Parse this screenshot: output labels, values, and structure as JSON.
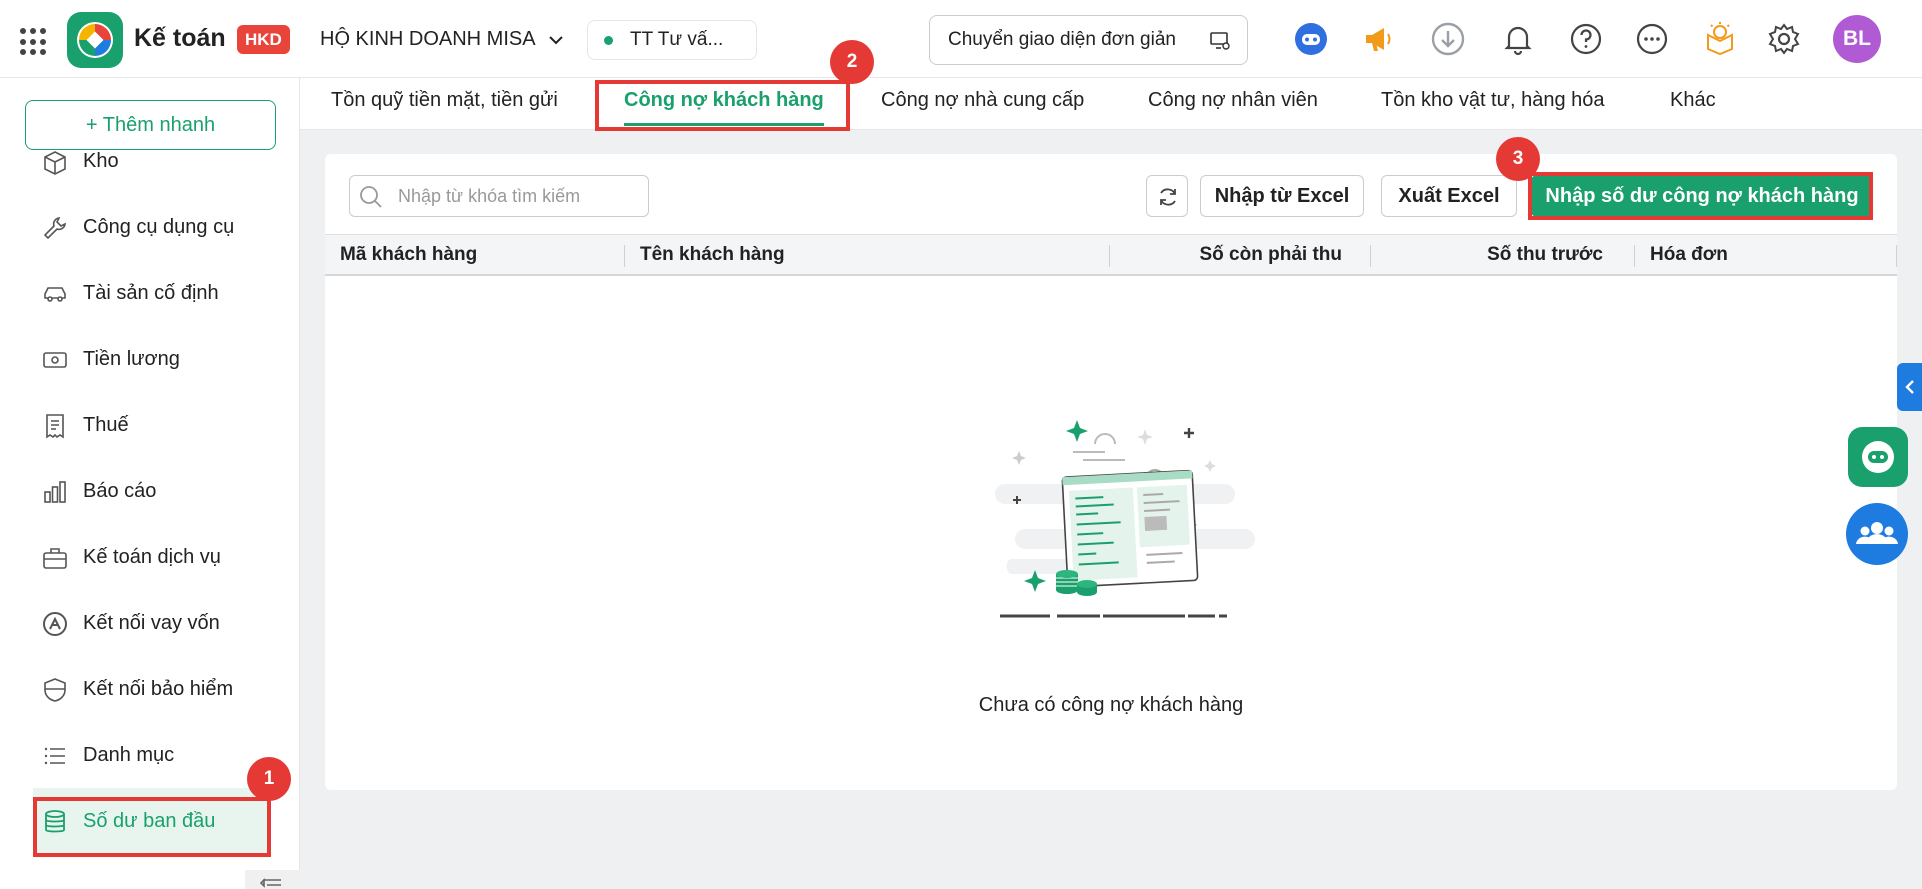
{
  "header": {
    "app_name": "Kế toán",
    "app_badge": "HKD",
    "company": "HỘ KINH DOANH MISA",
    "branch": "TT Tư vấ...",
    "switch_ui": "Chuyển giao diện đơn giản",
    "avatar_initials": "BL",
    "icons": [
      "apps-grid-icon",
      "misa-assistant-icon",
      "megaphone-icon",
      "download-icon",
      "bell-icon",
      "help-icon",
      "more-icon",
      "idea-icon",
      "gear-icon"
    ]
  },
  "sidebar": {
    "quick_add": "+ Thêm nhanh",
    "items": [
      {
        "label": "Kho",
        "icon": "warehouse-icon"
      },
      {
        "label": "Công cụ dụng cụ",
        "icon": "wrench-icon"
      },
      {
        "label": "Tài sản cố định",
        "icon": "car-icon"
      },
      {
        "label": "Tiền lương",
        "icon": "money-icon"
      },
      {
        "label": "Thuế",
        "icon": "receipt-icon"
      },
      {
        "label": "Báo cáo",
        "icon": "bar-chart-icon"
      },
      {
        "label": "Kế toán dịch vụ",
        "icon": "briefcase-icon"
      },
      {
        "label": "Kết nối vay vốn",
        "icon": "loan-icon"
      },
      {
        "label": "Kết nối bảo hiểm",
        "icon": "shield-icon"
      },
      {
        "label": "Danh mục",
        "icon": "list-icon"
      },
      {
        "label": "Số dư ban đầu",
        "icon": "database-icon",
        "active": true
      }
    ]
  },
  "tabs": [
    {
      "label": "Tồn quỹ tiền mặt, tiền gửi"
    },
    {
      "label": "Công nợ khách hàng",
      "active": true
    },
    {
      "label": "Công nợ nhà cung cấp"
    },
    {
      "label": "Công nợ nhân viên"
    },
    {
      "label": "Tồn kho vật tư, hàng hóa"
    },
    {
      "label": "Khác"
    }
  ],
  "toolbar": {
    "search_placeholder": "Nhập từ khóa tìm kiếm",
    "import_excel": "Nhập từ Excel",
    "export_excel": "Xuất Excel",
    "import_balance": "Nhập số dư công nợ khách hàng"
  },
  "table": {
    "columns": [
      "Mã khách hàng",
      "Tên khách hàng",
      "Số còn phải thu",
      "Số thu trước",
      "Hóa đơn"
    ],
    "empty_message": "Chưa có công nợ khách hàng"
  },
  "annotations": {
    "step1": "1",
    "step2": "2",
    "step3": "3"
  },
  "colors": {
    "brand_green": "#1aa06d",
    "annotation_red": "#e53935",
    "accent_blue": "#1e7be0"
  }
}
